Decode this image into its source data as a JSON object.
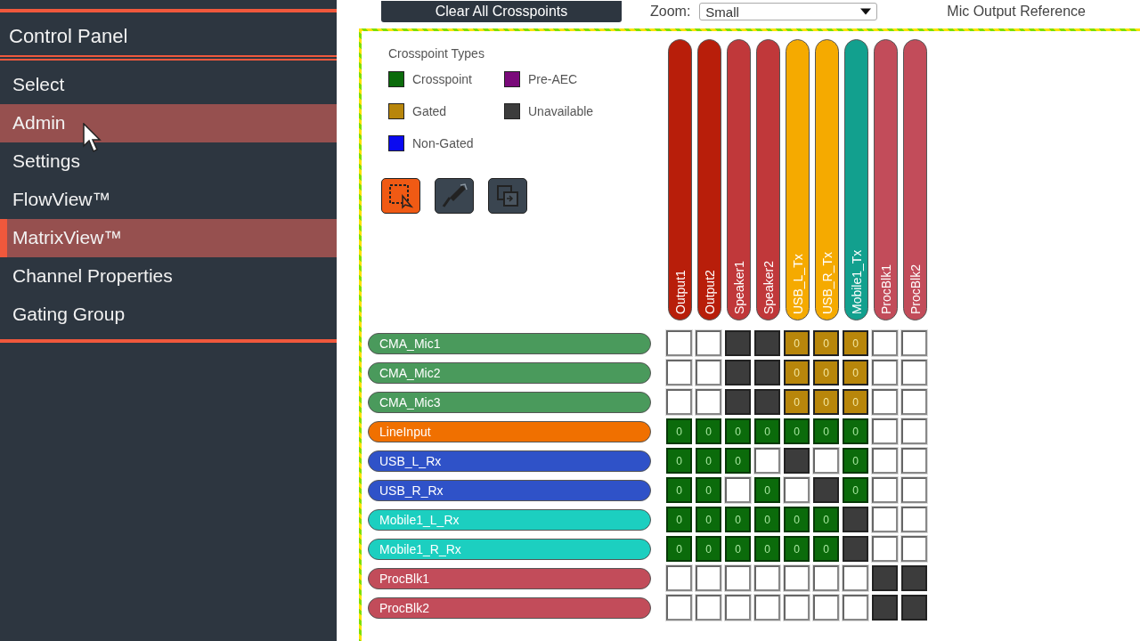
{
  "toolbar": {
    "clear_button": "Clear All Crosspoints",
    "zoom_label": "Zoom:",
    "zoom_value": "Small",
    "reference_label": "Mic Output Reference"
  },
  "sidebar": {
    "title": "Control Panel",
    "items": [
      {
        "label": "Select",
        "selected": false,
        "hovered": false
      },
      {
        "label": "Admin",
        "selected": false,
        "hovered": true
      },
      {
        "label": "Settings",
        "selected": false,
        "hovered": false
      },
      {
        "label": "FlowView™",
        "selected": false,
        "hovered": false
      },
      {
        "label": "MatrixView™",
        "selected": true,
        "hovered": false
      },
      {
        "label": "Channel Properties",
        "selected": false,
        "hovered": false
      },
      {
        "label": "Gating Group",
        "selected": false,
        "hovered": false
      }
    ]
  },
  "legend": {
    "title": "Crosspoint Types",
    "items": [
      {
        "label": "Crosspoint",
        "color": "#0b6b0b"
      },
      {
        "label": "Pre-AEC",
        "color": "#7a0a7a"
      },
      {
        "label": "Gated",
        "color": "#b8860b"
      },
      {
        "label": "Unavailable",
        "color": "#3c3c3c"
      },
      {
        "label": "Non-Gated",
        "color": "#0a0af0"
      }
    ]
  },
  "tools": [
    {
      "kind": "select",
      "selected": true
    },
    {
      "kind": "paint",
      "selected": false
    },
    {
      "kind": "copy",
      "selected": false
    }
  ],
  "matrix": {
    "columns": [
      {
        "label": "Output1",
        "color": "#b81e0a"
      },
      {
        "label": "Output2",
        "color": "#b81e0a"
      },
      {
        "label": "Speaker1",
        "color": "#c0383a"
      },
      {
        "label": "Speaker2",
        "color": "#c0383a"
      },
      {
        "label": "USB_L_Tx",
        "color": "#f5aa00"
      },
      {
        "label": "USB_R_Tx",
        "color": "#f5aa00"
      },
      {
        "label": "Mobile1_Tx",
        "color": "#12a08e"
      },
      {
        "label": "ProcBlk1",
        "color": "#c24c5a"
      },
      {
        "label": "ProcBlk2",
        "color": "#c24c5a"
      }
    ],
    "rows": [
      {
        "label": "CMA_Mic1",
        "color": "#4a9a5c",
        "cells": [
          {
            "kind": "empty"
          },
          {
            "kind": "empty"
          },
          {
            "kind": "unavailable"
          },
          {
            "kind": "unavailable"
          },
          {
            "kind": "gated",
            "value": "0"
          },
          {
            "kind": "gated",
            "value": "0"
          },
          {
            "kind": "gated",
            "value": "0"
          },
          {
            "kind": "empty"
          },
          {
            "kind": "empty"
          }
        ]
      },
      {
        "label": "CMA_Mic2",
        "color": "#4a9a5c",
        "cells": [
          {
            "kind": "empty"
          },
          {
            "kind": "empty"
          },
          {
            "kind": "unavailable"
          },
          {
            "kind": "unavailable"
          },
          {
            "kind": "gated",
            "value": "0"
          },
          {
            "kind": "gated",
            "value": "0"
          },
          {
            "kind": "gated",
            "value": "0"
          },
          {
            "kind": "empty"
          },
          {
            "kind": "empty"
          }
        ]
      },
      {
        "label": "CMA_Mic3",
        "color": "#4a9a5c",
        "cells": [
          {
            "kind": "empty"
          },
          {
            "kind": "empty"
          },
          {
            "kind": "unavailable"
          },
          {
            "kind": "unavailable"
          },
          {
            "kind": "gated",
            "value": "0"
          },
          {
            "kind": "gated",
            "value": "0"
          },
          {
            "kind": "gated",
            "value": "0"
          },
          {
            "kind": "empty"
          },
          {
            "kind": "empty"
          }
        ]
      },
      {
        "label": "LineInput",
        "color": "#f07000",
        "cells": [
          {
            "kind": "crosspoint",
            "value": "0"
          },
          {
            "kind": "crosspoint",
            "value": "0"
          },
          {
            "kind": "crosspoint",
            "value": "0"
          },
          {
            "kind": "crosspoint",
            "value": "0"
          },
          {
            "kind": "crosspoint",
            "value": "0"
          },
          {
            "kind": "crosspoint",
            "value": "0"
          },
          {
            "kind": "crosspoint",
            "value": "0"
          },
          {
            "kind": "empty"
          },
          {
            "kind": "empty"
          }
        ]
      },
      {
        "label": "USB_L_Rx",
        "color": "#2f52c8",
        "cells": [
          {
            "kind": "crosspoint",
            "value": "0"
          },
          {
            "kind": "crosspoint",
            "value": "0"
          },
          {
            "kind": "crosspoint",
            "value": "0"
          },
          {
            "kind": "empty"
          },
          {
            "kind": "unavailable"
          },
          {
            "kind": "empty"
          },
          {
            "kind": "crosspoint",
            "value": "0"
          },
          {
            "kind": "empty"
          },
          {
            "kind": "empty"
          }
        ]
      },
      {
        "label": "USB_R_Rx",
        "color": "#2f52c8",
        "cells": [
          {
            "kind": "crosspoint",
            "value": "0"
          },
          {
            "kind": "crosspoint",
            "value": "0"
          },
          {
            "kind": "empty"
          },
          {
            "kind": "crosspoint",
            "value": "0"
          },
          {
            "kind": "empty"
          },
          {
            "kind": "unavailable"
          },
          {
            "kind": "crosspoint",
            "value": "0"
          },
          {
            "kind": "empty"
          },
          {
            "kind": "empty"
          }
        ]
      },
      {
        "label": "Mobile1_L_Rx",
        "color": "#1ccfc0",
        "cells": [
          {
            "kind": "crosspoint",
            "value": "0"
          },
          {
            "kind": "crosspoint",
            "value": "0"
          },
          {
            "kind": "crosspoint",
            "value": "0"
          },
          {
            "kind": "crosspoint",
            "value": "0"
          },
          {
            "kind": "crosspoint",
            "value": "0"
          },
          {
            "kind": "crosspoint",
            "value": "0"
          },
          {
            "kind": "unavailable"
          },
          {
            "kind": "empty"
          },
          {
            "kind": "empty"
          }
        ]
      },
      {
        "label": "Mobile1_R_Rx",
        "color": "#1ccfc0",
        "cells": [
          {
            "kind": "crosspoint",
            "value": "0"
          },
          {
            "kind": "crosspoint",
            "value": "0"
          },
          {
            "kind": "crosspoint",
            "value": "0"
          },
          {
            "kind": "crosspoint",
            "value": "0"
          },
          {
            "kind": "crosspoint",
            "value": "0"
          },
          {
            "kind": "crosspoint",
            "value": "0"
          },
          {
            "kind": "unavailable"
          },
          {
            "kind": "empty"
          },
          {
            "kind": "empty"
          }
        ]
      },
      {
        "label": "ProcBlk1",
        "color": "#c24c5a",
        "cells": [
          {
            "kind": "empty"
          },
          {
            "kind": "empty"
          },
          {
            "kind": "empty"
          },
          {
            "kind": "empty"
          },
          {
            "kind": "empty"
          },
          {
            "kind": "empty"
          },
          {
            "kind": "empty"
          },
          {
            "kind": "unavailable"
          },
          {
            "kind": "unavailable"
          }
        ]
      },
      {
        "label": "ProcBlk2",
        "color": "#c24c5a",
        "cells": [
          {
            "kind": "empty"
          },
          {
            "kind": "empty"
          },
          {
            "kind": "empty"
          },
          {
            "kind": "empty"
          },
          {
            "kind": "empty"
          },
          {
            "kind": "empty"
          },
          {
            "kind": "empty"
          },
          {
            "kind": "unavailable"
          },
          {
            "kind": "unavailable"
          }
        ]
      }
    ]
  }
}
